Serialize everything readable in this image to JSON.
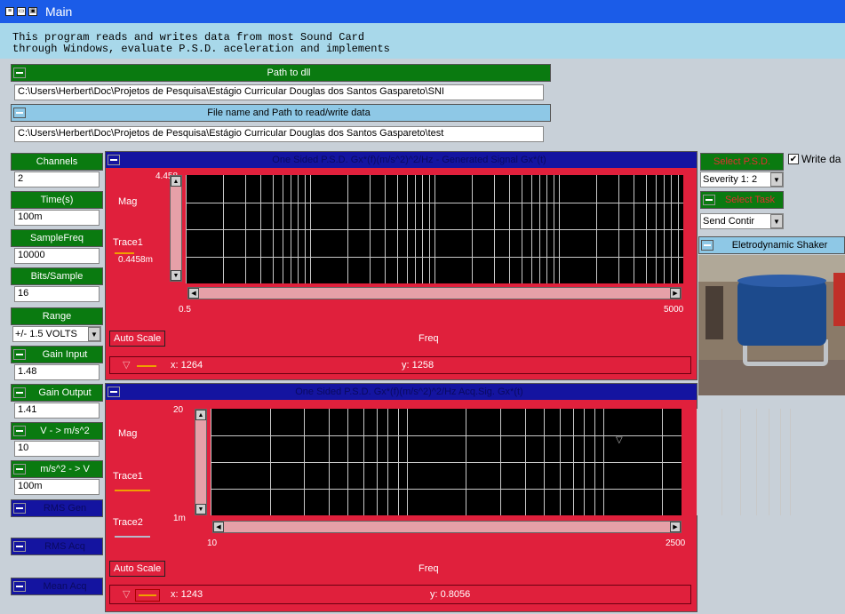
{
  "window": {
    "title": "Main"
  },
  "description": [
    "This program reads and writes data from most Sound Card",
    "through Windows, evaluate P.S.D. aceleration and implements"
  ],
  "dll": {
    "header": "Path to dll",
    "value": "C:\\Users\\Herbert\\Doc\\Projetos de Pesquisa\\Estágio Curricular Douglas dos Santos Gaspareto\\SNI"
  },
  "datafile": {
    "header": "File name and Path to read/write data",
    "value": "C:\\Users\\Herbert\\Doc\\Projetos de Pesquisa\\Estágio Curricular Douglas dos Santos Gaspareto\\test"
  },
  "params": {
    "channels_label": "Channels",
    "channels": "2",
    "time_label": "Time(s)",
    "time": "100m",
    "samplefreq_label": "SampleFreq",
    "samplefreq": "10000",
    "bits_label": "Bits/Sample",
    "bits": "16",
    "range_label": "Range",
    "range": "+/- 1.5 VOLTS",
    "gain_input_label": "Gain Input",
    "gain_input": "1.48",
    "gain_output_label": "Gain Output",
    "gain_output": "1.41",
    "v_to_ms2_label": "V - > m/s^2",
    "v_to_ms2": "10",
    "ms2_to_v_label": "m/s^2 - > V",
    "ms2_to_v": "100m",
    "rms_gen_label": "RMS Gen",
    "rms_acq_label": "RMS Acq",
    "mean_acq_label": "Mean Acq"
  },
  "plot1": {
    "title": "One Sided P.S.D. Gx*(f)(m/s^2)^2/Hz - Generated Signal Gx*(t)",
    "ymax": "4.458",
    "ymin": "0.4458m",
    "ylabel": "Mag",
    "trace1": "Trace1",
    "xmin": "0.5",
    "xmax": "5000",
    "xlabel": "Freq",
    "autoscale": "Auto Scale",
    "cursor_x": "x: 1264",
    "cursor_y": "y: 1258"
  },
  "plot2": {
    "title": "One Sided P.S.D. Gx*(f)(m/s^2)^2/Hz Acq.Sig. Gx*(t)",
    "ymax": "20",
    "ymin": "1m",
    "ylabel": "Mag",
    "trace1": "Trace1",
    "trace2": "Trace2",
    "xmin": "10",
    "xmax": "2500",
    "xlabel": "Freq",
    "autoscale": "Auto Scale",
    "cursor_x": "x: 1243",
    "cursor_y": "y: 0.8056"
  },
  "right": {
    "select_psd_label": "Select P.S.D.",
    "select_psd": "Severity 1: 2",
    "write_data_label": "Write da",
    "write_data_checked": true,
    "select_task_label": "Select Task",
    "select_task": "Send Contir",
    "shaker_label": "Eletrodynamic Shaker"
  }
}
